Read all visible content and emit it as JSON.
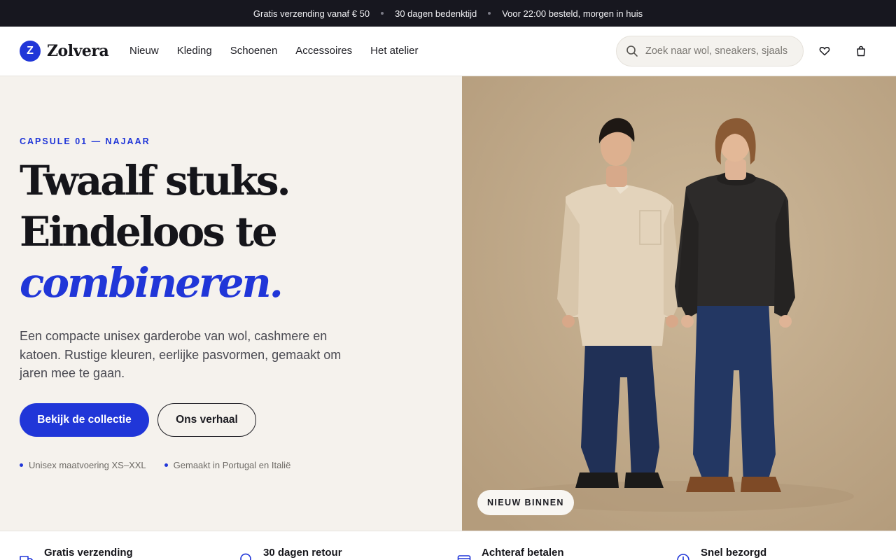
{
  "announcement": {
    "items": [
      "Gratis verzending vanaf € 50",
      "30 dagen bedenktijd",
      "Voor 22:00 besteld, morgen in huis"
    ]
  },
  "header": {
    "logo_letter": "Z",
    "brand": "Zolvera",
    "nav": [
      "Nieuw",
      "Kleding",
      "Schoenen",
      "Accessoires",
      "Het atelier"
    ],
    "search": {
      "placeholder": "Zoek naar wol, sneakers, sjaals",
      "value": "",
      "icon": "search-icon"
    },
    "icons": [
      "heart-icon",
      "shopping-bag-icon"
    ]
  },
  "hero": {
    "eyebrow": "CAPSULE 01 — NAJAAR",
    "headline_line1": "Twaalf stuks.",
    "headline_line2": "Eindeloos te",
    "headline_accent": "combineren.",
    "lead": "Een compacte unisex garderobe van wol, cashmere en katoen. Rustige kleuren, eerlijke pasvormen, gemaakt om jaren mee te gaan.",
    "primary_cta": "Bekijk de collectie",
    "secondary_cta": "Ons verhaal",
    "features": [
      "Unisex maatvoering XS–XXL",
      "Gemaakt in Portugal en Italië"
    ],
    "image_badge": "NIEUW BINNEN"
  },
  "usp": [
    {
      "title": "Gratis verzending",
      "icon": "truck-icon"
    },
    {
      "title": "30 dagen retour",
      "icon": "return-icon"
    },
    {
      "title": "Achteraf betalen",
      "icon": "card-icon"
    },
    {
      "title": "Snel bezorgd",
      "icon": "clock-icon"
    }
  ],
  "colors": {
    "accent": "#2036d8",
    "announcement_bg": "#17171f",
    "hero_bg": "#f5f2ed",
    "photo_bg": "#c4ad8e"
  }
}
